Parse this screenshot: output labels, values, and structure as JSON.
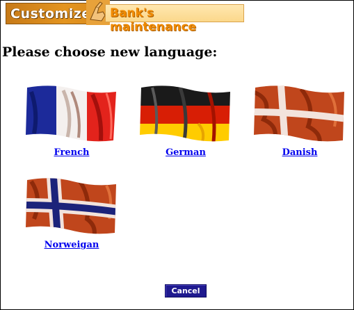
{
  "header": {
    "customize_label": "Customize",
    "section_label": "Bank's maintenance"
  },
  "title": "Please choose new language:",
  "languages": [
    {
      "label": "French",
      "flag": "france-flag-icon"
    },
    {
      "label": "German",
      "flag": "germany-flag-icon"
    },
    {
      "label": "Danish",
      "flag": "denmark-flag-icon"
    },
    {
      "label": "Norweigan",
      "flag": "norway-flag-icon"
    }
  ],
  "actions": {
    "cancel_label": "Cancel"
  },
  "colors": {
    "link": "#0000ee",
    "button": "#1f1a8f",
    "header_orange": "#e3941f"
  }
}
